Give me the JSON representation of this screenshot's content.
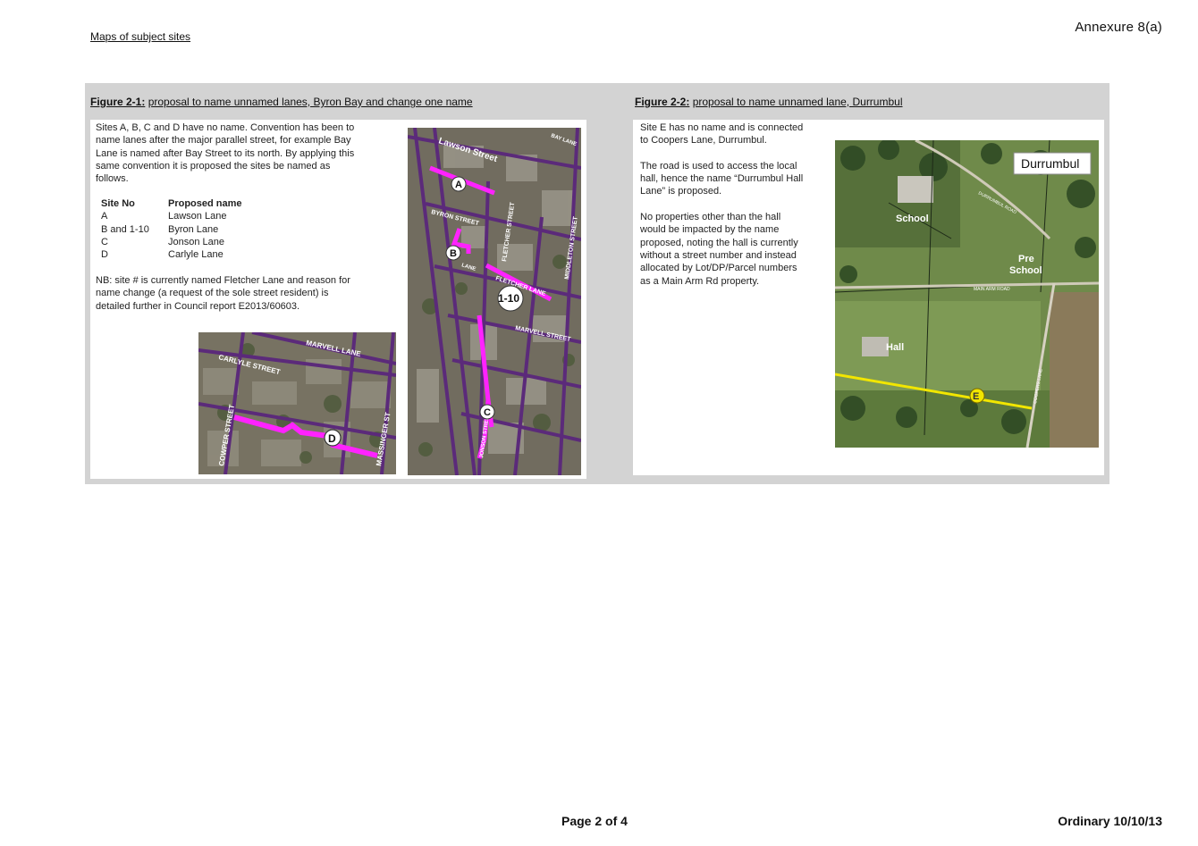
{
  "header": {
    "left_title": "Maps of subject sites",
    "right_title": "Annexure 8(a)"
  },
  "figure1": {
    "caption_label": "Figure 2-1:",
    "caption_text": "proposal to name unnamed lanes, Byron Bay and change one name",
    "paragraph1_lines": [
      "Sites A, B, C and D have no name. Convention has been to",
      "name lanes after the major parallel street, for example Bay",
      "Lane is named after Bay Street to its north. By applying this",
      "same convention it is proposed the sites be named as",
      "follows."
    ],
    "table_headers": [
      "Site No",
      "Proposed name"
    ],
    "table_rows": [
      [
        "A",
        "Lawson Lane"
      ],
      [
        "B and 1-10",
        "Byron Lane"
      ],
      [
        "C",
        "Jonson Lane"
      ],
      [
        "D",
        "Carlyle Lane"
      ]
    ],
    "nb_lines": [
      "NB: site # is currently named Fletcher Lane and reason for",
      "name change (a request of the sole street resident) is",
      "detailed further in Council report E2013/60603."
    ],
    "map_labels": {
      "lawson": "Lawson Street",
      "bay_lane": "BAY LANE",
      "byron": "BYRON STREET",
      "fletcher_st": "FLETCHER STREET",
      "middleton": "MIDDLETON STREET",
      "fletcher_lane": "FLETCHER LANE",
      "marvell_st": "MARVELL STREET",
      "jonson": "JONSON STREET",
      "lane": "LANE",
      "marvell_lane": "MARVELL LANE",
      "carlyle": "CARLYLE STREET",
      "cowper": "COWPER STREET",
      "massinger": "MASSINGER ST"
    },
    "markers": {
      "a": "A",
      "b": "B",
      "ten": "1-10",
      "c": "C",
      "d": "D"
    }
  },
  "figure2": {
    "caption_label": "Figure 2-2:",
    "caption_text": "proposal to name unnamed lane, Durrumbul",
    "para1_lines": [
      "Site E has no name and is connected",
      "to Coopers Lane, Durrumbul."
    ],
    "para2_lines": [
      "The road is used to access the local",
      "hall, hence the name “Durrumbul Hall",
      "Lane” is proposed."
    ],
    "para3_lines": [
      "No properties other than the hall",
      "would be impacted by the name",
      "proposed, noting the hall is currently",
      "without a street number and instead",
      "allocated by Lot/DP/Parcel numbers",
      "as a Main Arm Rd property."
    ],
    "map_labels": {
      "place": "Durrumbul",
      "school": "School",
      "pre": "Pre",
      "pre_school": "School",
      "hall": "Hall",
      "durrumbul_road": "DURRUMBUL ROAD",
      "main_arm_road": "MAIN ARM ROAD",
      "coopers_lane": "COOPERS LANE"
    },
    "marker": "E"
  },
  "footer": {
    "page": "Page 2 of 4",
    "meeting": "Ordinary 10/10/13"
  },
  "colors": {
    "lane_highlight": "#ff22ff",
    "road_line": "#5b2a7a",
    "site_e_line": "#f2e600"
  }
}
